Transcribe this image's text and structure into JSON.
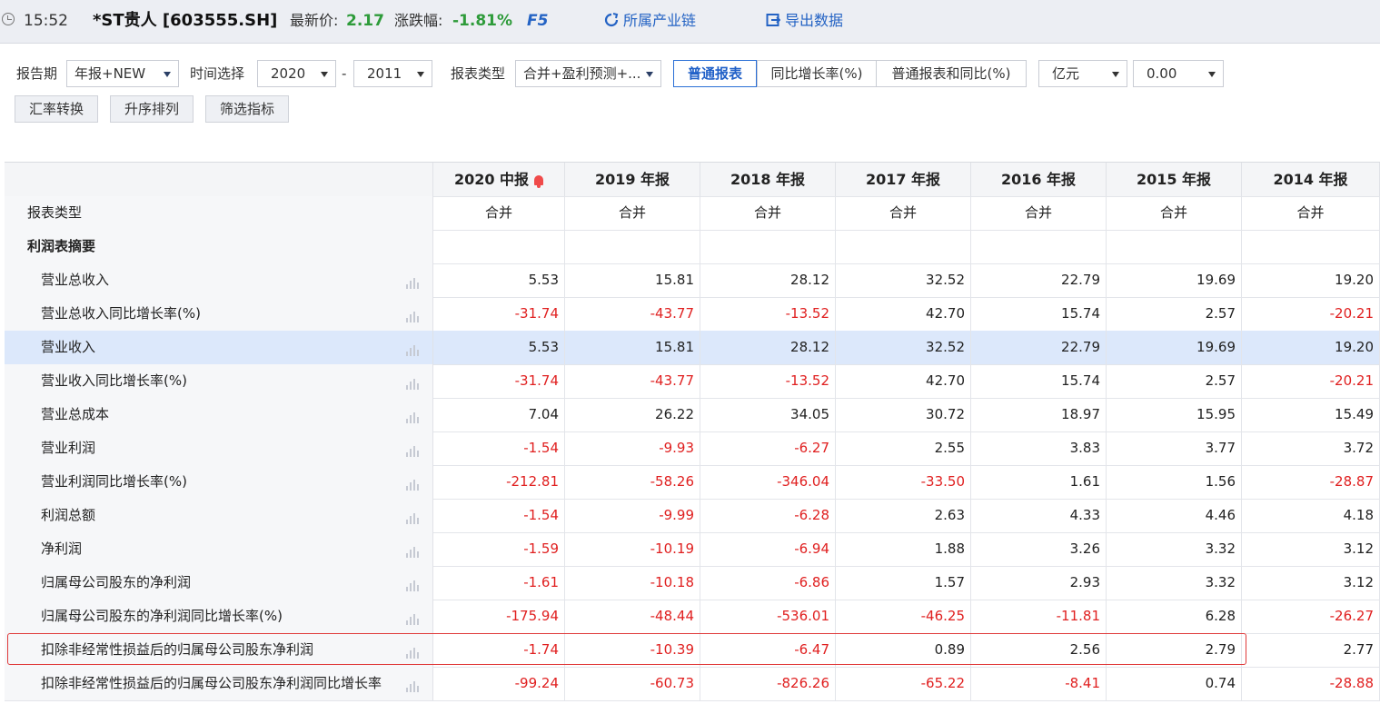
{
  "header": {
    "time": "15:52",
    "stock_title": "*ST贵人 [603555.SH]",
    "latest_price_label": "最新价:",
    "latest_price_value": "2.17",
    "change_label": "涨跌幅:",
    "change_value": "-1.81%",
    "f5_label": "F5",
    "industry_chain_label": "所属产业链",
    "export_label": "导出数据"
  },
  "filters": {
    "report_period_label": "报告期",
    "report_period_value": "年报+NEW",
    "time_select_label": "时间选择",
    "time_from": "2020",
    "dash": "-",
    "time_to": "2011",
    "report_type_label": "报表类型",
    "report_type_value": "合并+盈利预测+...",
    "view_tabs": [
      "普通报表",
      "同比增长率(%)",
      "普通报表和同比(%)"
    ],
    "unit_value": "亿元",
    "decimal_value": "0.00",
    "buttons": [
      "汇率转换",
      "升序排列",
      "筛选指标"
    ]
  },
  "table": {
    "columns": [
      "2020 中报",
      "2019 年报",
      "2018 年报",
      "2017 年报",
      "2016 年报",
      "2015 年报",
      "2014 年报"
    ],
    "report_type_row": {
      "label": "报表类型",
      "values": [
        "合并",
        "合并",
        "合并",
        "合并",
        "合并",
        "合并",
        "合并"
      ]
    },
    "section_title": "利润表摘要",
    "rows": [
      {
        "label": "营业总收入",
        "values": [
          "5.53",
          "15.81",
          "28.12",
          "32.52",
          "22.79",
          "19.69",
          "19.20"
        ]
      },
      {
        "label": "营业总收入同比增长率(%)",
        "values": [
          "-31.74",
          "-43.77",
          "-13.52",
          "42.70",
          "15.74",
          "2.57",
          "-20.21"
        ]
      },
      {
        "label": "营业收入",
        "values": [
          "5.53",
          "15.81",
          "28.12",
          "32.52",
          "22.79",
          "19.69",
          "19.20"
        ]
      },
      {
        "label": "营业收入同比增长率(%)",
        "values": [
          "-31.74",
          "-43.77",
          "-13.52",
          "42.70",
          "15.74",
          "2.57",
          "-20.21"
        ]
      },
      {
        "label": "营业总成本",
        "values": [
          "7.04",
          "26.22",
          "34.05",
          "30.72",
          "18.97",
          "15.95",
          "15.49"
        ]
      },
      {
        "label": "营业利润",
        "values": [
          "-1.54",
          "-9.93",
          "-6.27",
          "2.55",
          "3.83",
          "3.77",
          "3.72"
        ]
      },
      {
        "label": "营业利润同比增长率(%)",
        "values": [
          "-212.81",
          "-58.26",
          "-346.04",
          "-33.50",
          "1.61",
          "1.56",
          "-28.87"
        ]
      },
      {
        "label": "利润总额",
        "values": [
          "-1.54",
          "-9.99",
          "-6.28",
          "2.63",
          "4.33",
          "4.46",
          "4.18"
        ]
      },
      {
        "label": "净利润",
        "values": [
          "-1.59",
          "-10.19",
          "-6.94",
          "1.88",
          "3.26",
          "3.32",
          "3.12"
        ]
      },
      {
        "label": "归属母公司股东的净利润",
        "values": [
          "-1.61",
          "-10.18",
          "-6.86",
          "1.57",
          "2.93",
          "3.32",
          "3.12"
        ]
      },
      {
        "label": "归属母公司股东的净利润同比增长率(%)",
        "values": [
          "-175.94",
          "-48.44",
          "-536.01",
          "-46.25",
          "-11.81",
          "6.28",
          "-26.27"
        ]
      },
      {
        "label": "扣除非经常性损益后的归属母公司股东净利润",
        "values": [
          "-1.74",
          "-10.39",
          "-6.47",
          "0.89",
          "2.56",
          "2.79",
          "2.77"
        ]
      },
      {
        "label": "扣除非经常性损益后的归属母公司股东净利润同比增长率",
        "values": [
          "-99.24",
          "-60.73",
          "-826.26",
          "-65.22",
          "-8.41",
          "0.74",
          "-28.88"
        ]
      }
    ]
  },
  "colors": {
    "accent": "#2463c4",
    "negative": "#e02020",
    "up": "#2e9b3a",
    "highlight_row": "#dce8fb"
  }
}
